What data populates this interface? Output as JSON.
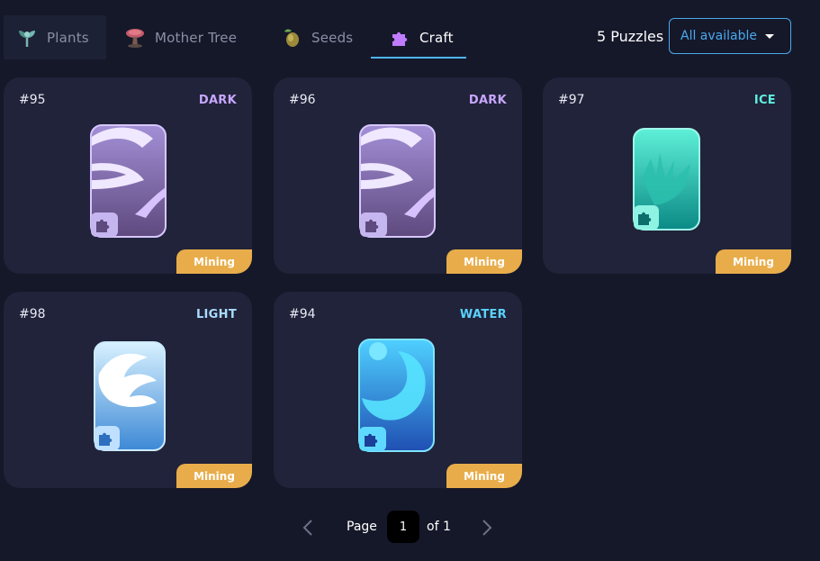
{
  "tabs": [
    {
      "label": "Plants",
      "icon": "plant-icon"
    },
    {
      "label": "Mother Tree",
      "icon": "mother-tree-icon"
    },
    {
      "label": "Seeds",
      "icon": "seed-icon"
    },
    {
      "label": "Craft",
      "icon": "puzzle-piece-icon",
      "selected": true
    }
  ],
  "header": {
    "count_label": "5 Puzzles",
    "filter_value": "All available"
  },
  "cards": [
    {
      "number": "#95",
      "element": "DARK",
      "element_color": "#c9a6ff",
      "status": "Mining"
    },
    {
      "number": "#96",
      "element": "DARK",
      "element_color": "#c9a6ff",
      "status": "Mining"
    },
    {
      "number": "#97",
      "element": "ICE",
      "element_color": "#5ff0e0",
      "status": "Mining"
    },
    {
      "number": "#98",
      "element": "LIGHT",
      "element_color": "#a9dcff",
      "status": "Mining"
    },
    {
      "number": "#94",
      "element": "WATER",
      "element_color": "#5ad2ff",
      "status": "Mining"
    }
  ],
  "pagination": {
    "page_label": "Page",
    "current_page": "1",
    "of_label": "of 1"
  },
  "colors": {
    "background": "#151829",
    "card": "#202339",
    "accent": "#4aa8ee",
    "badge": "#e8ad4a"
  }
}
